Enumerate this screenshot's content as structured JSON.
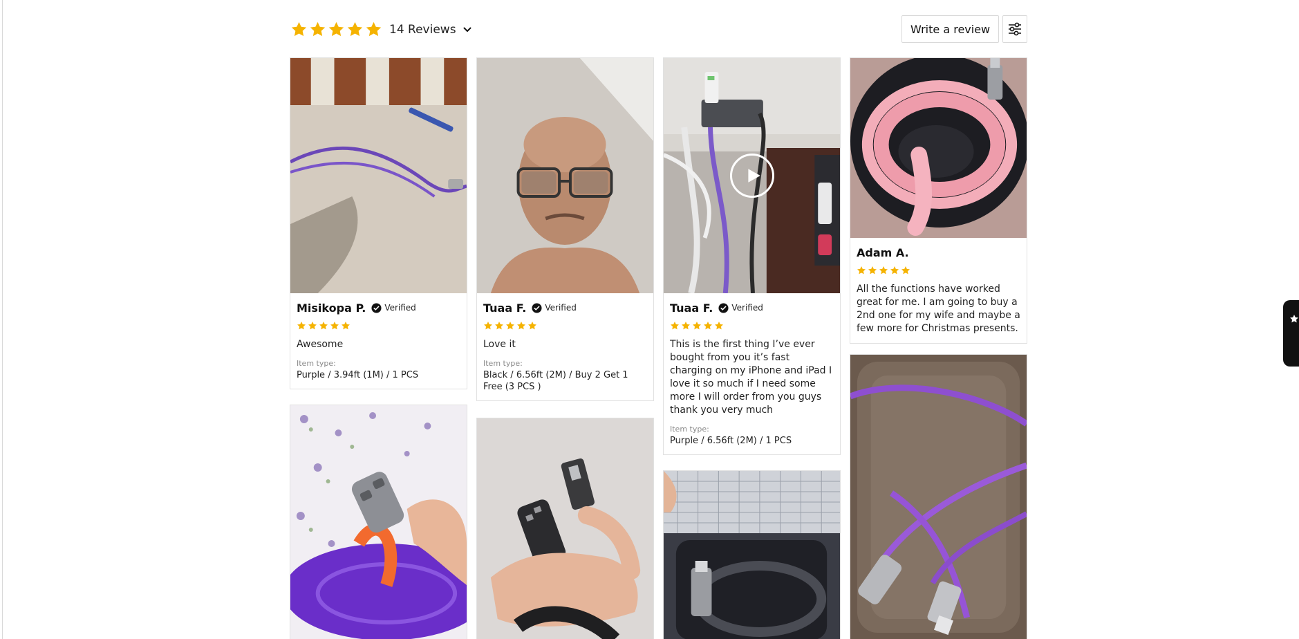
{
  "summary": {
    "rating": 5,
    "reviews_label": "14 Reviews"
  },
  "actions": {
    "write_review_label": "Write a review"
  },
  "colors": {
    "star": "#f5b301",
    "border": "#e1e1e1",
    "badge": "#111111"
  },
  "icons": {
    "dropdown": "chevron-down-icon",
    "filter": "sliders-icon",
    "verified": "verified-check-icon",
    "video": "play-icon",
    "side_tab": "star-icon"
  },
  "reviews": [
    {
      "name": "Misikopa P.",
      "verified": "Verified",
      "rating": 5,
      "text": "Awesome",
      "item_label": "Item type:",
      "item_value": "Purple / 3.94ft (1M) / 1 PCS"
    },
    {
      "name": "Tuaa F.",
      "verified": "Verified",
      "rating": 5,
      "text": "Love it",
      "item_label": "Item type:",
      "item_value": "Black / 6.56ft (2M) / Buy 2 Get 1 Free (3 PCS )"
    },
    {
      "name": "Tuaa F.",
      "verified": "Verified",
      "rating": 5,
      "text": "This is the first thing I’ve ever bought from you it’s fast charging on my iPhone and iPad I love it so much if I need some more I will order from you guys thank you very much",
      "item_label": "Item type:",
      "item_value": "Purple / 6.56ft (2M) / 1 PCS"
    },
    {
      "name": "Adam A.",
      "rating": 5,
      "text": "All the functions have worked great for me. I am going to buy a 2nd one for my wife and maybe a few more for Christmas presents."
    }
  ]
}
